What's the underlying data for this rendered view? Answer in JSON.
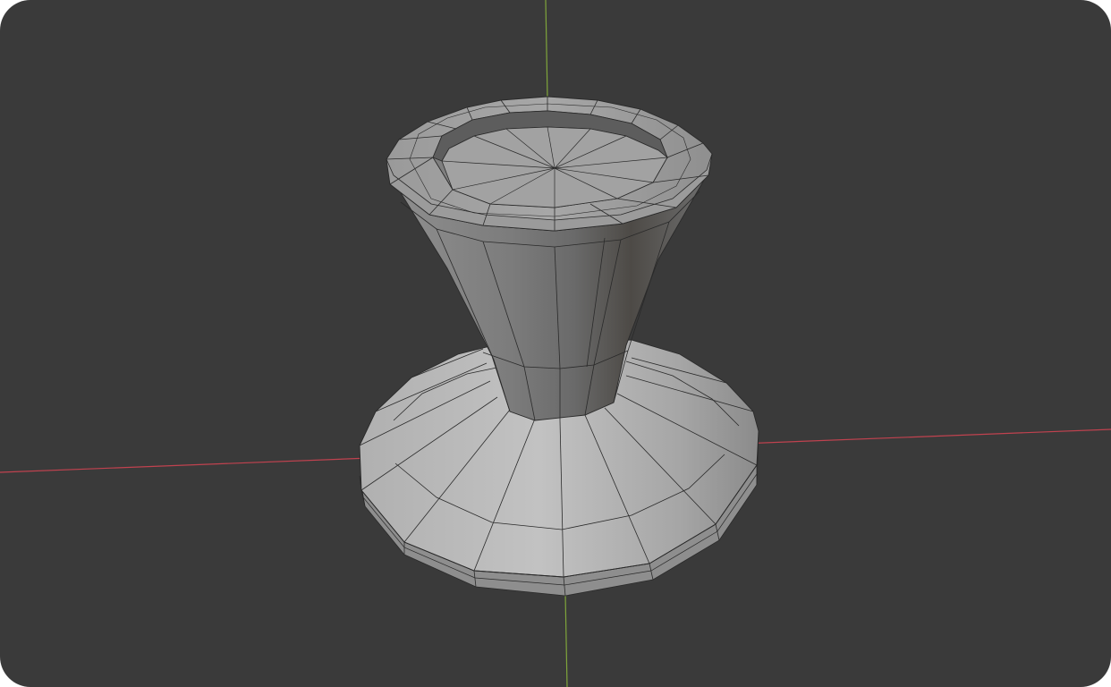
{
  "viewport": {
    "background_color": "#3a3a3a",
    "shading": "solid",
    "overlay": "wireframe"
  },
  "axes": {
    "x_axis_color": "#c0424f",
    "y_axis_color": "#7fa53a"
  },
  "mesh": {
    "object": "goblet",
    "base_color": "#a9a9a9",
    "edge_color": "#2a2a2a"
  }
}
